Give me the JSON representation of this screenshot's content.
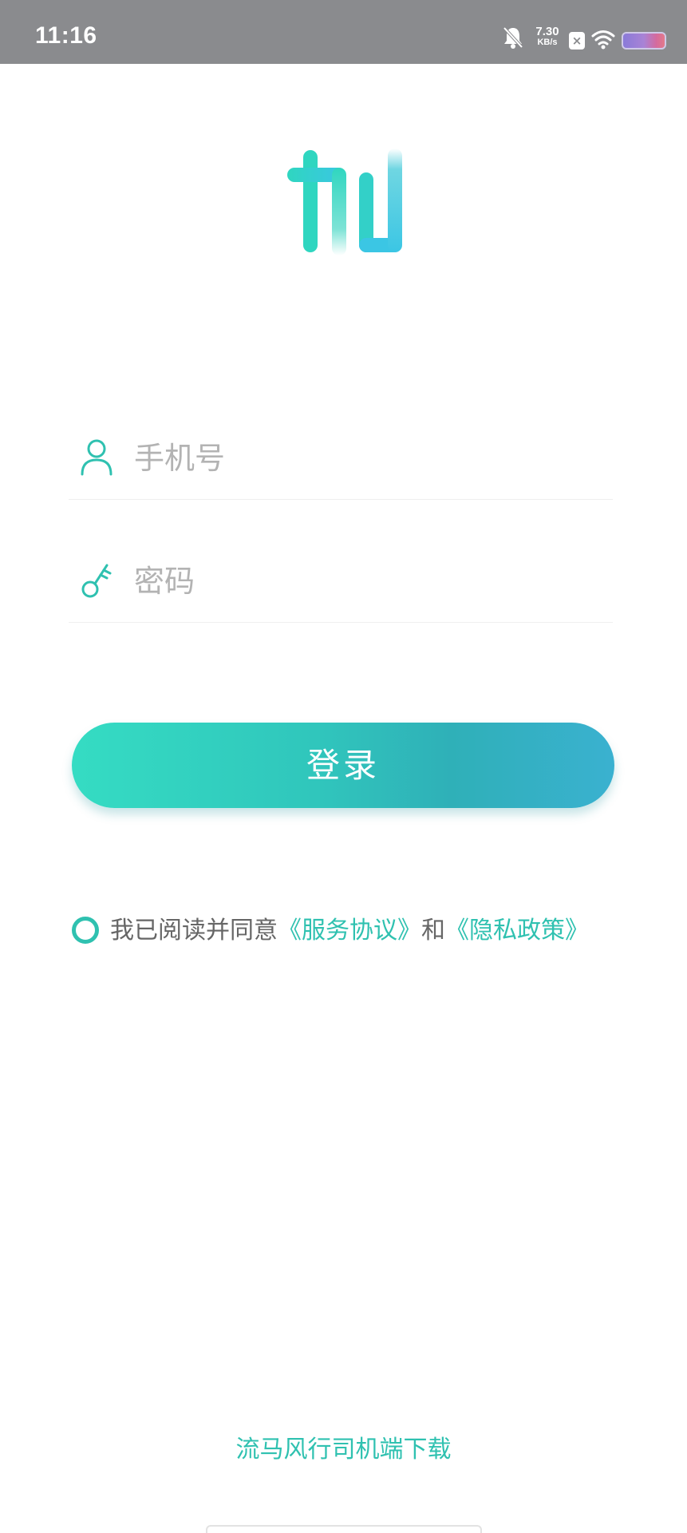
{
  "status_bar": {
    "time": "11:16",
    "net_speed_value": "7.30",
    "net_speed_unit": "KB/s",
    "icons": [
      "bell-muted-icon",
      "close-notification-icon",
      "wifi-icon",
      "battery-icon"
    ]
  },
  "logo": {
    "icon": "jia-logo-icon",
    "colors": [
      "#2fd6c0",
      "#3bc0e0"
    ]
  },
  "login_form": {
    "phone": {
      "placeholder": "手机号",
      "value": "",
      "icon": "user-icon"
    },
    "password": {
      "placeholder": "密码",
      "value": "",
      "icon": "key-icon"
    },
    "submit_label": "登录"
  },
  "agreement": {
    "checked": false,
    "prefix": "我已阅读并同意",
    "service_link": "《服务协议》",
    "and": "和",
    "privacy_link": "《隐私政策》"
  },
  "footer": {
    "download_label": "流马风行司机端下载"
  },
  "colors": {
    "accent": "#2fc1b0",
    "placeholder": "#b3b3b3",
    "status_bar": "#8a8b8e"
  }
}
